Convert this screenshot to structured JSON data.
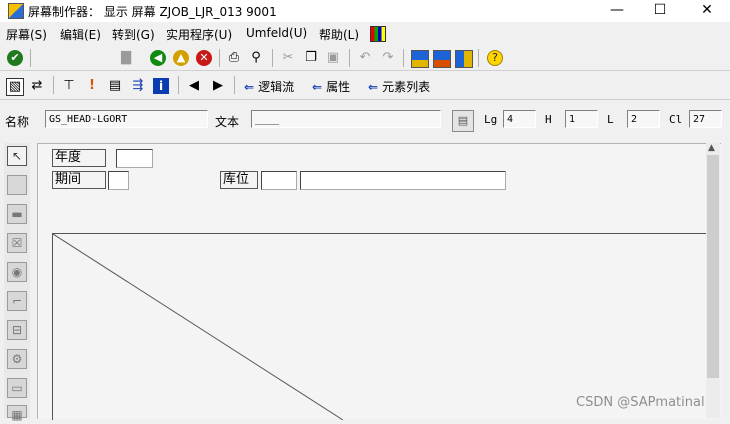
{
  "window": {
    "title": "屏幕制作器： 显示 屏幕 ZJOB_LJR_013 9001",
    "minimize": "—",
    "maximize": "☐",
    "close": "✕"
  },
  "menu": {
    "items": [
      "屏幕(S)",
      "编辑(E)",
      "转到(G)",
      "实用程序(U)",
      "Umfeld(U)",
      "帮助(L)"
    ]
  },
  "toolbar": {
    "icons": {
      "ok": "✔",
      "save": "▇",
      "back": "◀",
      "exit": "▲",
      "cancel": "✕",
      "print": "⎙",
      "find": "⚲",
      "cut": "✂",
      "copy": "❐",
      "paste": "▣",
      "undo": "↶",
      "redo": "↷",
      "help": "?"
    }
  },
  "app_toolbar": {
    "icons": {
      "layout": "▧",
      "toggle": "⇄",
      "hierarchy": "⊤",
      "info_pin": "!",
      "element": "▤",
      "flow": "⇶",
      "info": "i",
      "prev": "◀",
      "next": "▶"
    },
    "buttons": {
      "flow_logic": "逻辑流",
      "attributes": "属性",
      "element_list": "元素列表"
    },
    "arrow": "⇐"
  },
  "attributes": {
    "name_label": "名称",
    "name_value": "GS_HEAD-LGORT",
    "text_label": "文本",
    "text_value": "____",
    "lg_label": "Lg",
    "lg_value": "4",
    "h_label": "H",
    "h_value": "1",
    "l_label": "L",
    "l_value": "2",
    "cl_label": "Cl",
    "cl_value": "27"
  },
  "palette": {
    "icons": [
      "↖",
      "",
      "▬",
      "☒",
      "◉",
      "⌐",
      "⊟",
      "⚙",
      "▭",
      "▦"
    ]
  },
  "canvas": {
    "labels": {
      "year": "年度",
      "period": "期间",
      "storage_location": "库位"
    }
  },
  "scrollbar": {
    "up_arrow": "▲"
  },
  "watermark": "CSDN @SAPmatinal"
}
